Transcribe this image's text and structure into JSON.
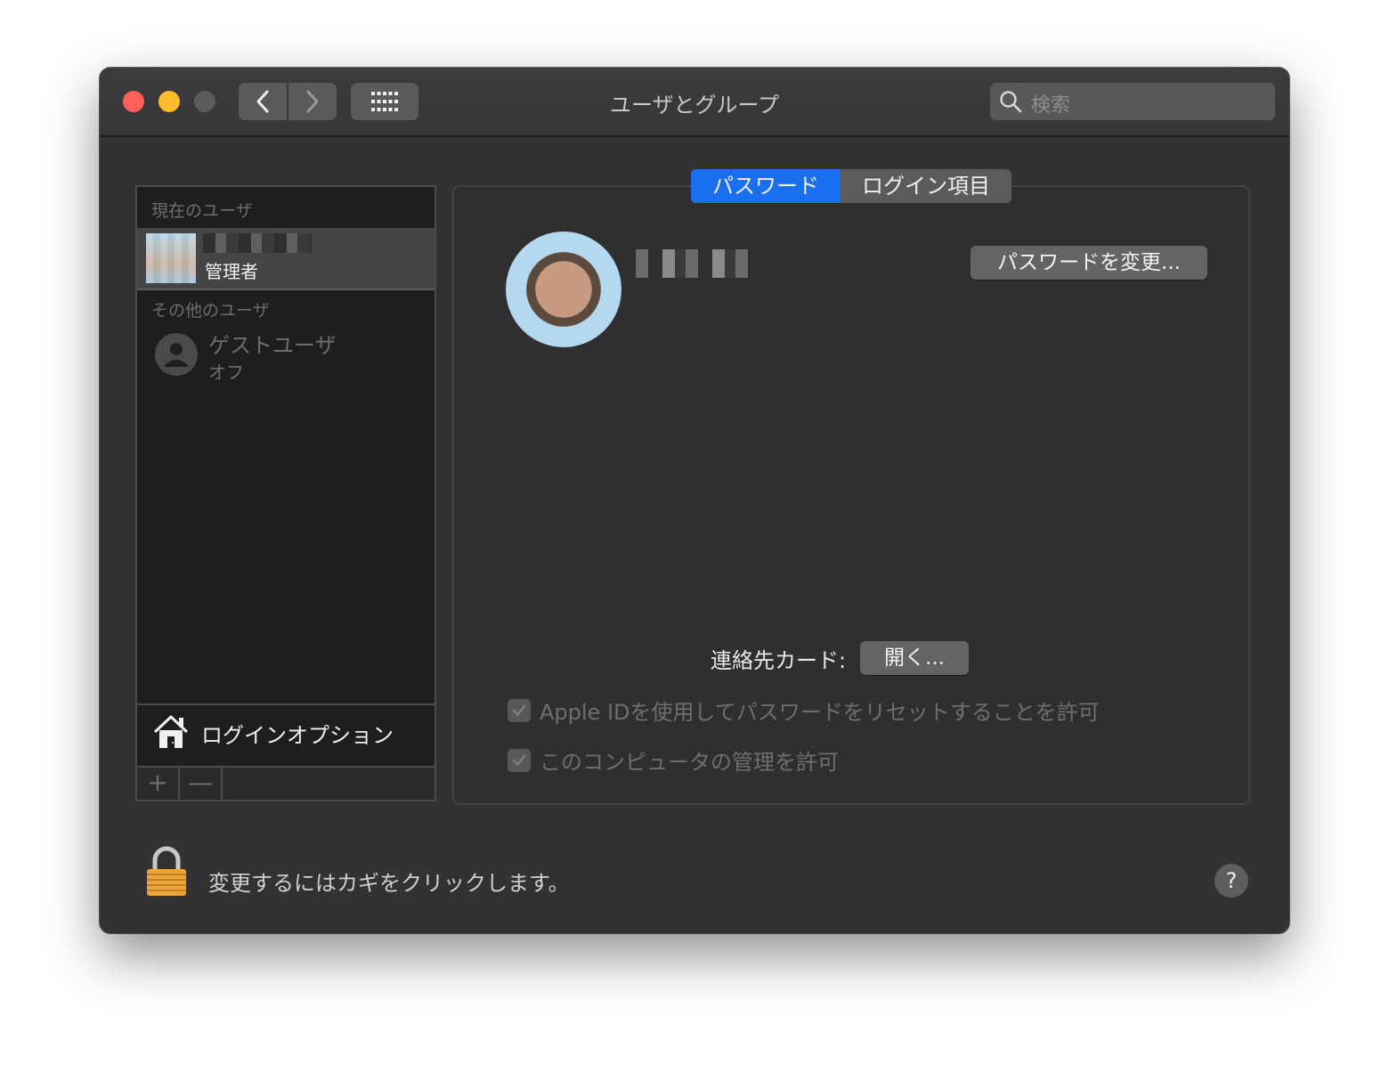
{
  "window": {
    "title": "ユーザとグループ",
    "search_placeholder": "検索"
  },
  "sidebar": {
    "current_header": "現在のユーザ",
    "current_user": {
      "role": "管理者"
    },
    "other_header": "その他のユーザ",
    "guest_user": {
      "name": "ゲストユーザ",
      "status": "オフ"
    },
    "login_options_label": "ログインオプション",
    "add_label": "+",
    "remove_label": "—"
  },
  "tabs": [
    {
      "label": "パスワード",
      "active": true
    },
    {
      "label": "ログイン項目",
      "active": false
    }
  ],
  "main": {
    "change_password_label": "パスワードを変更...",
    "contact_card_label": "連絡先カード:",
    "open_label": "開く...",
    "checkboxes": [
      {
        "label": "Apple IDを使用してパスワードをリセットすることを許可",
        "checked": true,
        "enabled": false
      },
      {
        "label": "このコンピュータの管理を許可",
        "checked": true,
        "enabled": false
      }
    ]
  },
  "footer": {
    "lock_text": "変更するにはカギをクリックします。",
    "help_label": "?"
  },
  "colors": {
    "accent": "#1a6ef0",
    "traffic_red": "#ff5f57",
    "traffic_yellow": "#febc2e",
    "window_bg": "#323234"
  },
  "icons": [
    "back-icon",
    "forward-icon",
    "grid-icon",
    "search-icon",
    "person-icon",
    "house-icon",
    "checkmark-icon",
    "lock-icon",
    "help-icon"
  ]
}
